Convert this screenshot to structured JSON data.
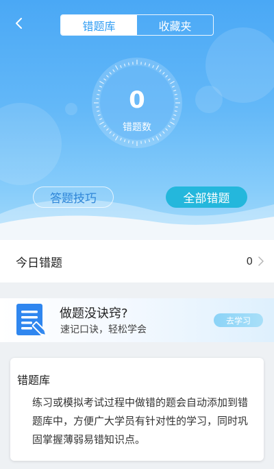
{
  "header": {
    "tabs": [
      {
        "label": "错题库",
        "active": true
      },
      {
        "label": "收藏夹",
        "active": false
      }
    ],
    "dial": {
      "value": "0",
      "label": "错题数"
    },
    "buttons": {
      "tips": "答题技巧",
      "all_errors": "全部错题"
    }
  },
  "today": {
    "label": "今日错题",
    "count": "0"
  },
  "promo": {
    "title": "做题没诀窍?",
    "subtitle": "速记口诀，轻松学会",
    "button": "去学习"
  },
  "card": {
    "title": "错题库",
    "body": "练习或模拟考试过程中做错的题会自动添加到错题库中，方便广大学员有针对性的学习，同时巩固掌握薄弱易错知识点。"
  },
  "colors": {
    "header_top": "#4aa8f5",
    "accent_button": "#24b7dc",
    "active_tab_text": "#2f9cf3",
    "promo_icon": "#2f86ef"
  }
}
